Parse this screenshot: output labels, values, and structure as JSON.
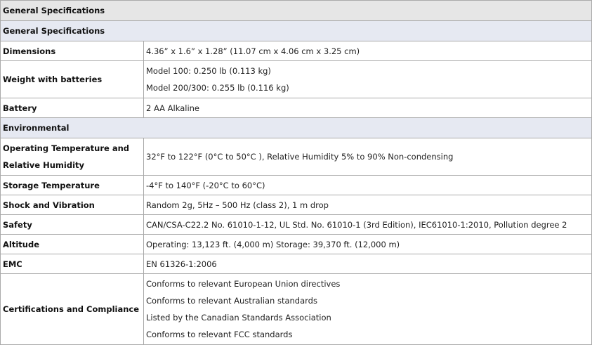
{
  "table": {
    "title": "General Specifications",
    "sections": [
      {
        "heading": "General Specifications",
        "rows": [
          {
            "label": [
              "Dimensions"
            ],
            "values": [
              "4.36” x 1.6” x 1.28” (11.07 cm x 4.06 cm x 3.25 cm)"
            ]
          },
          {
            "label": [
              "Weight with batteries"
            ],
            "values": [
              "Model 100: 0.250 lb (0.113 kg)",
              "Model 200/300: 0.255 lb (0.116 kg)"
            ]
          },
          {
            "label": [
              "Battery"
            ],
            "values": [
              "2 AA Alkaline"
            ]
          }
        ]
      },
      {
        "heading": "Environmental",
        "rows": [
          {
            "label": [
              "Operating Temperature and",
              "Relative Humidity"
            ],
            "values": [
              "32°F to 122°F (0°C to 50°C ), Relative Humidity 5% to 90% Non-condensing"
            ]
          },
          {
            "label": [
              "Storage Temperature"
            ],
            "values": [
              "-4°F to 140°F (-20°C to 60°C)"
            ]
          },
          {
            "label": [
              "Shock and Vibration"
            ],
            "values": [
              "Random 2g, 5Hz – 500 Hz (class 2), 1 m drop"
            ]
          },
          {
            "label": [
              "Safety"
            ],
            "values": [
              "CAN/CSA-C22.2 No. 61010-1-12, UL Std. No. 61010-1 (3rd Edition), IEC61010-1:2010, Pollution degree 2"
            ]
          },
          {
            "label": [
              "Altitude"
            ],
            "values": [
              "Operating: 13,123 ft. (4,000 m) Storage: 39,370 ft. (12,000 m)"
            ]
          },
          {
            "label": [
              "EMC"
            ],
            "values": [
              "EN 61326-1:2006"
            ]
          },
          {
            "label": [
              "Certifications and Compliance"
            ],
            "values": [
              "Conforms to relevant European Union directives",
              "Conforms to relevant Australian standards",
              "Listed by the Canadian Standards Association",
              "Conforms to relevant FCC standards"
            ]
          }
        ]
      }
    ]
  }
}
